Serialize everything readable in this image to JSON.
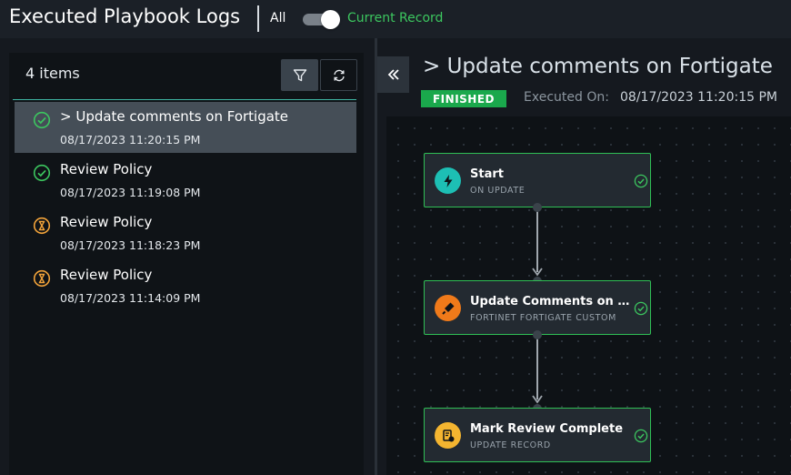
{
  "header": {
    "title": "Executed Playbook Logs",
    "toggle_all_label": "All",
    "toggle_current_label": "Current Record"
  },
  "list": {
    "count_label": "4 items",
    "items": [
      {
        "title": "> Update comments on Fortigate",
        "date": "08/17/2023 11:20:15 PM",
        "status": "finished"
      },
      {
        "title": "Review Policy",
        "date": "08/17/2023 11:19:08 PM",
        "status": "finished"
      },
      {
        "title": "Review Policy",
        "date": "08/17/2023 11:18:23 PM",
        "status": "pending"
      },
      {
        "title": "Review Policy",
        "date": "08/17/2023 11:14:09 PM",
        "status": "pending"
      }
    ]
  },
  "detail": {
    "title": "> Update comments on Fortigate",
    "status_badge": "FINISHED",
    "executed_on_label": "Executed On:",
    "executed_on_value": "08/17/2023 11:20:15 PM"
  },
  "flow": {
    "nodes": [
      {
        "title": "Start",
        "subtitle": "ON UPDATE",
        "icon": "lightning-icon",
        "icon_color": "#1dbfb4"
      },
      {
        "title": "Update Comments on Policy",
        "subtitle": "FORTINET FORTIGATE CUSTOM",
        "icon": "connector-plug-icon",
        "icon_color": "#f07a1a"
      },
      {
        "title": "Mark Review Complete",
        "subtitle": "UPDATE RECORD",
        "icon": "record-edit-icon",
        "icon_color": "#f4b530"
      }
    ]
  },
  "colors": {
    "accent_green": "#3cc65f",
    "badge_green": "#1aa84c",
    "pending_orange": "#f2a33a",
    "divider_teal": "#3fb7a4"
  }
}
